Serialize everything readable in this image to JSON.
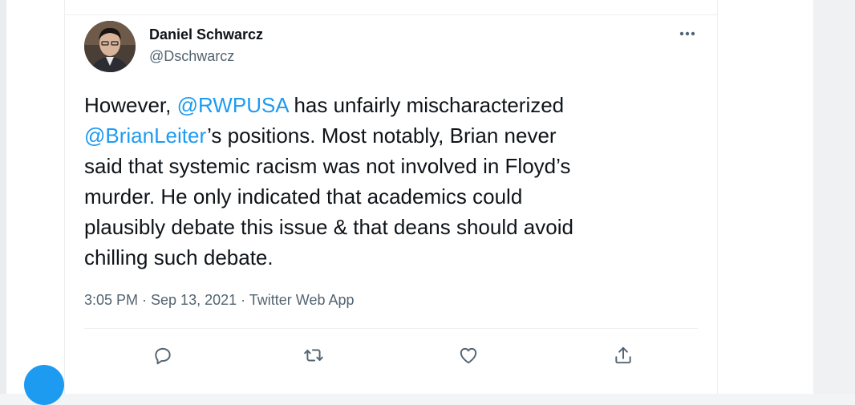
{
  "tweet": {
    "author": {
      "name": "Daniel Schwarcz",
      "handle": "@Dschwarcz"
    },
    "lines": [
      {
        "segments": [
          {
            "text": "However, ",
            "mention": false
          },
          {
            "text": "@RWPUSA",
            "mention": true
          },
          {
            "text": " has unfairly mischaracterized",
            "mention": false
          }
        ]
      },
      {
        "segments": [
          {
            "text": "@BrianLeiter",
            "mention": true
          },
          {
            "text": "’s positions. Most notably, Brian never",
            "mention": false
          }
        ]
      },
      {
        "segments": [
          {
            "text": "said that systemic racism was not involved in Floyd’s",
            "mention": false
          }
        ]
      },
      {
        "segments": [
          {
            "text": "murder. He only indicated that academics could",
            "mention": false
          }
        ]
      },
      {
        "segments": [
          {
            "text": "plausibly debate this issue & that deans should avoid",
            "mention": false
          }
        ]
      },
      {
        "segments": [
          {
            "text": "chilling such debate.",
            "mention": false
          }
        ]
      }
    ],
    "timestamp": "3:05 PM · Sep 13, 2021 · Twitter Web App"
  },
  "icons": {
    "more": "more-icon",
    "reply": "reply-icon",
    "retweet": "retweet-icon",
    "like": "heart-icon",
    "share": "share-icon"
  },
  "colors": {
    "mention": "#1d9bf0",
    "text": "#0f1419",
    "muted": "#536471",
    "divider": "#eceef0"
  }
}
